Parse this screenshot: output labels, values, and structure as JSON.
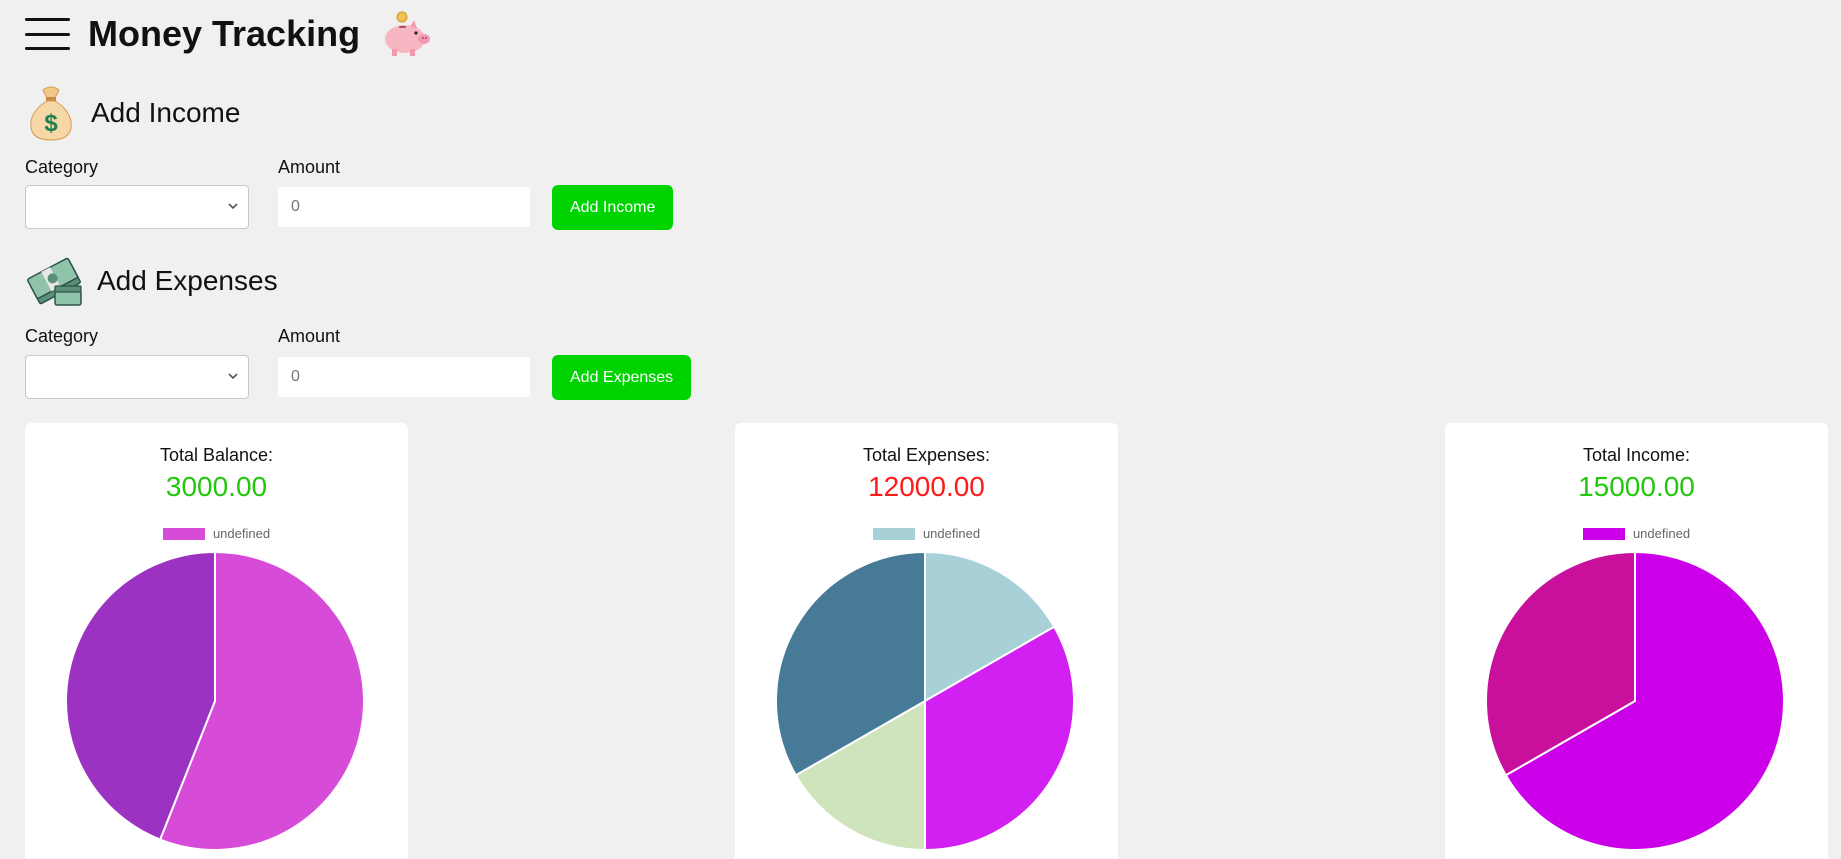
{
  "app": {
    "title": "Money Tracking",
    "menu_icon": "hamburger-menu-icon",
    "logo_icon": "piggy-bank-icon"
  },
  "income_form": {
    "heading": "Add Income",
    "icon": "money-bag-icon",
    "category_label": "Category",
    "category_value": "",
    "amount_label": "Amount",
    "amount_placeholder": "0",
    "submit_label": "Add Income"
  },
  "expense_form": {
    "heading": "Add Expenses",
    "icon": "money-stack-icon",
    "category_label": "Category",
    "category_value": "",
    "amount_label": "Amount",
    "amount_placeholder": "0",
    "submit_label": "Add Expenses"
  },
  "colors": {
    "accent_green": "#00d400",
    "negative_red": "#ff0000"
  },
  "cards": [
    {
      "title": "Total Balance:",
      "value": "3000.00",
      "value_color": "#22c80c",
      "legend": "undefined",
      "legend_color": "#d64cd9"
    },
    {
      "title": "Total Expenses:",
      "value": "12000.00",
      "value_color": "#ff1a1a",
      "legend": "undefined",
      "legend_color": "#a7d0d7"
    },
    {
      "title": "Total Income:",
      "value": "15000.00",
      "value_color": "#22c80c",
      "legend": "undefined",
      "legend_color": "#cc00e8"
    }
  ],
  "chart_data": [
    {
      "type": "pie",
      "series": [
        {
          "name": "undefined",
          "values": [
            56,
            44
          ],
          "colors": [
            "#d64cd9",
            "#9b32c2"
          ]
        }
      ]
    },
    {
      "type": "pie",
      "series": [
        {
          "name": "undefined",
          "values": [
            16.7,
            33.3,
            16.7,
            33.3
          ],
          "colors": [
            "#a7d0d7",
            "#d21ff2",
            "#cfe3bd",
            "#467a97"
          ]
        }
      ]
    },
    {
      "type": "pie",
      "series": [
        {
          "name": "undefined",
          "values": [
            66.7,
            33.3
          ],
          "colors": [
            "#cc00e8",
            "#c8109c"
          ]
        }
      ]
    }
  ]
}
